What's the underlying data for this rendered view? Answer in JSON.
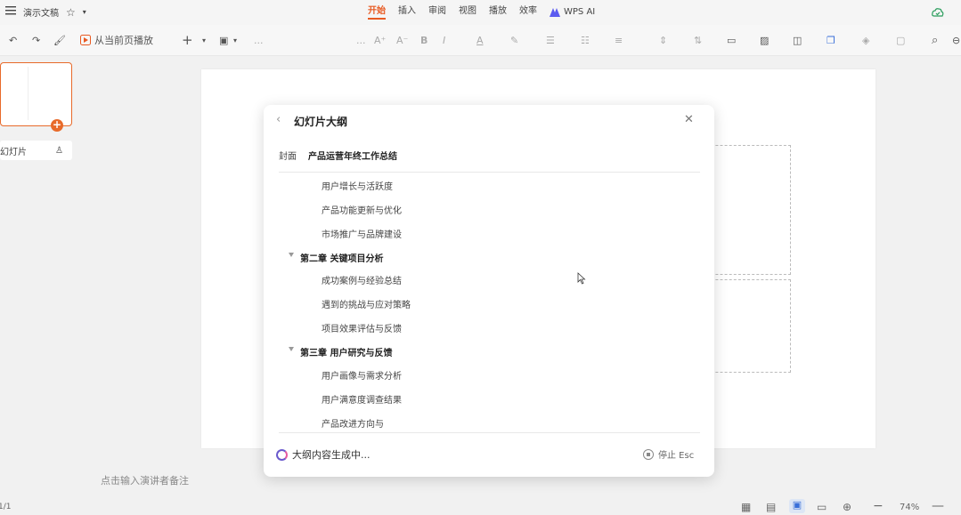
{
  "titlebar": {
    "doc_name": "演示文稿",
    "tabs": [
      "开始",
      "插入",
      "审阅",
      "视图",
      "播放",
      "效率"
    ],
    "ai_label": "WPS AI"
  },
  "toolbar": {
    "play_label": "从当前页播放",
    "font_name": "...",
    "font_size": "...",
    "font_color_letter": "A"
  },
  "sidebar": {
    "new_slide_label": "新幻灯片"
  },
  "notes": {
    "placeholder": "点击输入演讲者备注"
  },
  "dialog": {
    "title": "幻灯片大纲",
    "cover_label": "封面",
    "cover_title": "产品运营年终工作总结",
    "outline": [
      {
        "text": "用户增长与活跃度",
        "chapter": false
      },
      {
        "text": "产品功能更新与优化",
        "chapter": false
      },
      {
        "text": "市场推广与品牌建设",
        "chapter": false
      },
      {
        "text": "第二章   关键项目分析",
        "chapter": true
      },
      {
        "text": "成功案例与经验总结",
        "chapter": false
      },
      {
        "text": "遇到的挑战与应对策略",
        "chapter": false
      },
      {
        "text": "项目效果评估与反馈",
        "chapter": false
      },
      {
        "text": "第三章   用户研究与反馈",
        "chapter": true
      },
      {
        "text": "用户画像与需求分析",
        "chapter": false
      },
      {
        "text": "用户满意度调查结果",
        "chapter": false
      },
      {
        "text": "产品改进方向与",
        "chapter": false
      }
    ],
    "generating_text": "大纲内容生成中...",
    "stop_label": "停止 Esc"
  },
  "statusbar": {
    "page_indicator": "1/1",
    "zoom": "74%"
  },
  "colors": {
    "accent": "#e85a22",
    "spinner": "#6a5acd"
  }
}
